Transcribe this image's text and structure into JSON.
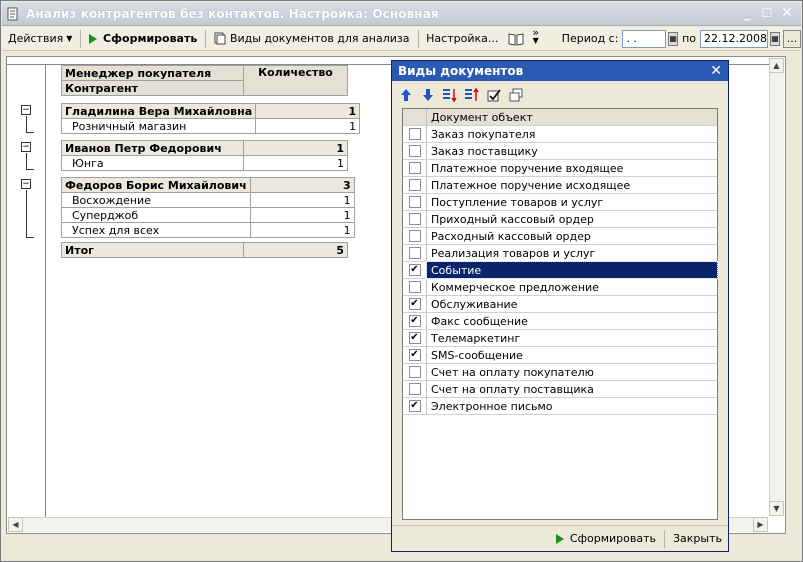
{
  "window": {
    "title": "Анализ контрагентов без контактов. Настройка: Основная"
  },
  "toolbar": {
    "actions_label": "Действия",
    "generate_label": "Сформировать",
    "doc_types_label": "Виды документов для анализа",
    "settings_label": "Настройка...",
    "more_label": "»",
    "period_label": "Период с:",
    "period_from_value": " .  .",
    "period_to_label": "по",
    "period_to_value": "22.12.2008",
    "ellipsis_label": "..."
  },
  "report": {
    "header_manager": "Менеджер покупателя",
    "header_counterparty": "Контрагент",
    "header_quantity": "Количество",
    "groups": [
      {
        "manager": "Гладилина Вера Михайловна",
        "count": "1",
        "items": [
          {
            "name": "Розничный магазин",
            "count": "1"
          }
        ]
      },
      {
        "manager": "Иванов Петр Федорович",
        "count": "1",
        "items": [
          {
            "name": "Юнга",
            "count": "1"
          }
        ]
      },
      {
        "manager": "Федоров Борис Михайлович",
        "count": "3",
        "items": [
          {
            "name": "Восхождение",
            "count": "1"
          },
          {
            "name": "Суперджоб",
            "count": "1"
          },
          {
            "name": "Успех для всех",
            "count": "1"
          }
        ]
      }
    ],
    "total_label": "Итог",
    "total_value": "5"
  },
  "dialog": {
    "title": "Виды документов",
    "column_header": "Документ объект",
    "rows": [
      {
        "label": "Заказ покупателя",
        "checked": false
      },
      {
        "label": "Заказ поставщику",
        "checked": false
      },
      {
        "label": "Платежное поручение входящее",
        "checked": false
      },
      {
        "label": "Платежное поручение исходящее",
        "checked": false
      },
      {
        "label": "Поступление товаров и услуг",
        "checked": false
      },
      {
        "label": "Приходный кассовый ордер",
        "checked": false
      },
      {
        "label": "Расходный кассовый ордер",
        "checked": false
      },
      {
        "label": "Реализация товаров и услуг",
        "checked": false
      },
      {
        "label": "Событие",
        "checked": true,
        "selected": true
      },
      {
        "label": "Коммерческое предложение",
        "checked": false
      },
      {
        "label": "Обслуживание",
        "checked": true
      },
      {
        "label": "Факс сообщение",
        "checked": true
      },
      {
        "label": "Телемаркетинг",
        "checked": true
      },
      {
        "label": "SMS-сообщение",
        "checked": true
      },
      {
        "label": "Счет на оплату покупателю",
        "checked": false
      },
      {
        "label": "Счет на оплату поставщика",
        "checked": false
      },
      {
        "label": "Электронное письмо",
        "checked": true
      }
    ],
    "generate_label": "Сформировать",
    "close_label": "Закрыть"
  },
  "colors": {
    "dialog_title_bg": "#2a5ab1",
    "selection_bg": "#0a246a",
    "generate_icon": "#1b8f1b"
  }
}
